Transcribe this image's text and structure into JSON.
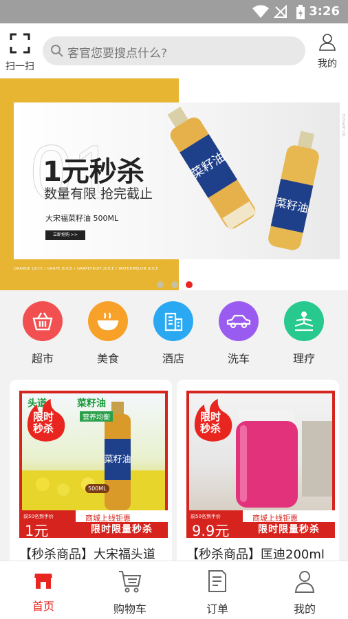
{
  "status_bar": {
    "time": "3:26"
  },
  "header": {
    "scan_label": "扫一扫",
    "search_placeholder": "客官您要搜点什么?",
    "mine_label": "我的"
  },
  "banner": {
    "bg_number": "01",
    "title": "1元秒杀",
    "subtitle": "数量有限 抢完截止",
    "product": "大宋福菜籽油 500ML",
    "buy_button": "立即抢购 >>",
    "juice_line": "ORANGE JUICE  /  GRAPE JUICE  /  GRAPEFRUIT JUICE  /  WATERMELON JUICE",
    "side_text": "ELEGANT OIL",
    "slides": 3,
    "active_slide": 3
  },
  "categories": [
    {
      "label": "超市",
      "icon": "basket-icon",
      "color": "#f25050"
    },
    {
      "label": "美食",
      "icon": "bowl-icon",
      "color": "#f7a128"
    },
    {
      "label": "酒店",
      "icon": "building-icon",
      "color": "#2aa9f2"
    },
    {
      "label": "洗车",
      "icon": "car-icon",
      "color": "#9a5cf0"
    },
    {
      "label": "理疗",
      "icon": "meditation-icon",
      "color": "#27c98f"
    }
  ],
  "products": [
    {
      "name": "【秒杀商品】大宋福头道",
      "flash_text_1": "限时",
      "flash_text_2": "秒杀",
      "photo_text_1": "头道",
      "photo_text_2": "菜籽油",
      "photo_text_3": "营养均衡",
      "bottle_tag": "500ML",
      "price_note": "前50名到手价",
      "price": "1元",
      "promo_top": "商城上线钜惠",
      "promo_main": "限时限量秒杀"
    },
    {
      "name": "【秒杀商品】匡迪200ml",
      "flash_text_1": "限时",
      "flash_text_2": "秒杀",
      "price_note": "前50名到手价",
      "price": "9.9元",
      "promo_top": "商城上线钜惠",
      "promo_main": "限时限量秒杀"
    }
  ],
  "tabbar": [
    {
      "label": "首页",
      "icon": "shop-icon",
      "active": true
    },
    {
      "label": "购物车",
      "icon": "cart-icon",
      "active": false
    },
    {
      "label": "订单",
      "icon": "order-icon",
      "active": false
    },
    {
      "label": "我的",
      "icon": "user-icon",
      "active": false
    }
  ],
  "colors": {
    "accent": "#e8261f",
    "banner_yellow": "#e7b532",
    "promo_red": "#d6231d"
  }
}
